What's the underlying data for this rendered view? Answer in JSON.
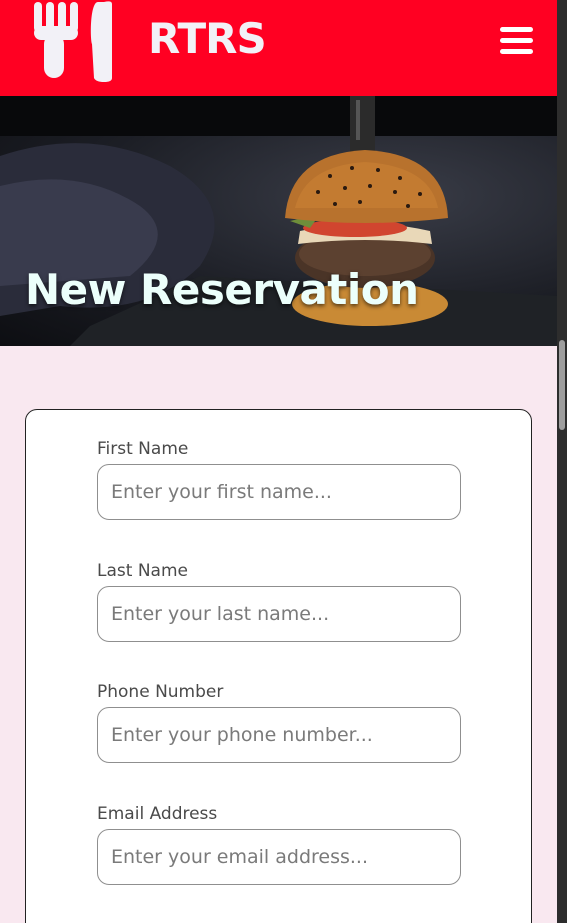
{
  "header": {
    "logo_text": "RTRS",
    "brand_color": "#ff0022",
    "menu_icon": "hamburger-menu-icon"
  },
  "hero": {
    "title": "New Reservation",
    "image": "burger-photo"
  },
  "form": {
    "fields": [
      {
        "label": "First Name",
        "placeholder": "Enter your first name..."
      },
      {
        "label": "Last Name",
        "placeholder": "Enter your last name..."
      },
      {
        "label": "Phone Number",
        "placeholder": "Enter your phone number..."
      },
      {
        "label": "Email Address",
        "placeholder": "Enter your email address..."
      }
    ]
  },
  "colors": {
    "page_background": "#f9e8f0",
    "card_background": "#ffffff"
  }
}
